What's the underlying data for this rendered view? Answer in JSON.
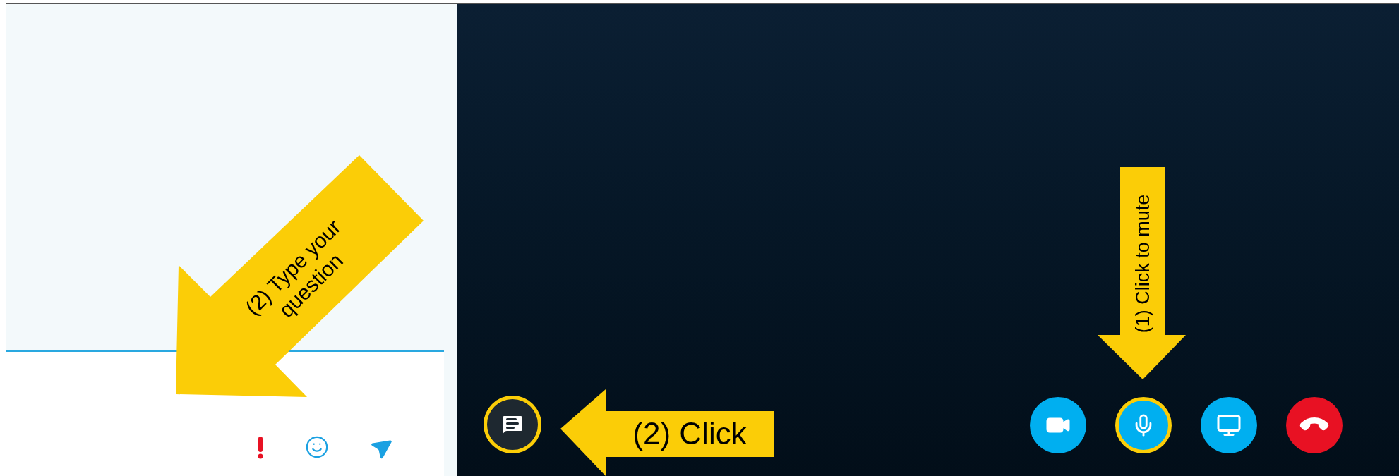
{
  "compose_tools": [
    {
      "kind": "priority"
    },
    {
      "kind": "emoji"
    },
    {
      "kind": "send"
    }
  ],
  "chat_button": {
    "highlighted": true
  },
  "call_controls": [
    {
      "kind": "video",
      "highlighted": false
    },
    {
      "kind": "mic",
      "highlighted": true
    },
    {
      "kind": "screen",
      "highlighted": false
    },
    {
      "kind": "hangup",
      "highlighted": false
    }
  ],
  "annotations": [
    {
      "kind": "diagonal",
      "lines": [
        "(2) Type your",
        "question"
      ]
    },
    {
      "kind": "left",
      "lines": [
        "(2) Click"
      ]
    },
    {
      "kind": "down",
      "lines": [
        "(1) Click to mute"
      ]
    }
  ]
}
